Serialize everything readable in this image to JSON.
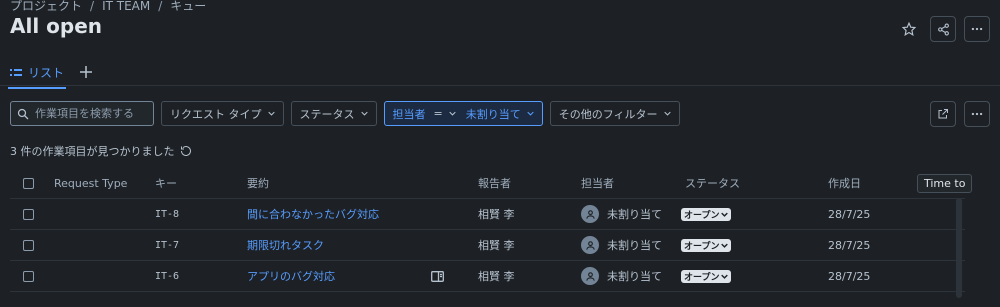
{
  "breadcrumb": [
    "プロジェクト",
    "IT TEAM",
    "キュー"
  ],
  "page_title": "All open",
  "tabs": [
    {
      "label": "リスト"
    }
  ],
  "search": {
    "placeholder": "作業項目を検索する"
  },
  "filters": {
    "request_type": "リクエスト タイプ",
    "status": "ステータス",
    "assignee_label": "担当者",
    "assignee_operator": "=",
    "assignee_value": "未割り当て",
    "other": "その他のフィルター"
  },
  "result_count": "3 件の作業項目が見つかりました",
  "columns": {
    "request_type": "Request Type",
    "key": "キー",
    "summary": "要約",
    "reporter": "報告者",
    "assignee": "担当者",
    "status": "ステータス",
    "created": "作成日",
    "time_to": "Time to"
  },
  "rows": [
    {
      "key": "IT-8",
      "summary": "間に合わなかったバグ対応",
      "reporter": "相賢 李",
      "assignee": "未割り当て",
      "status": "オープン",
      "created": "28/7/25"
    },
    {
      "key": "IT-7",
      "summary": "期限切れタスク",
      "reporter": "相賢 李",
      "assignee": "未割り当て",
      "status": "オープン",
      "created": "28/7/25"
    },
    {
      "key": "IT-6",
      "summary": "アプリのバグ対応",
      "reporter": "相賢 李",
      "assignee": "未割り当て",
      "status": "オープン",
      "created": "28/7/25"
    }
  ],
  "icons": [
    "star-icon",
    "share-icon",
    "more-icon",
    "list-icon",
    "plus-icon",
    "search-icon",
    "chevron-down-icon",
    "external-link-icon",
    "refresh-icon",
    "user-icon",
    "panel-icon"
  ],
  "colors": {
    "background": "#1d2125",
    "accent": "#579dff",
    "text": "#b6c2cf"
  }
}
